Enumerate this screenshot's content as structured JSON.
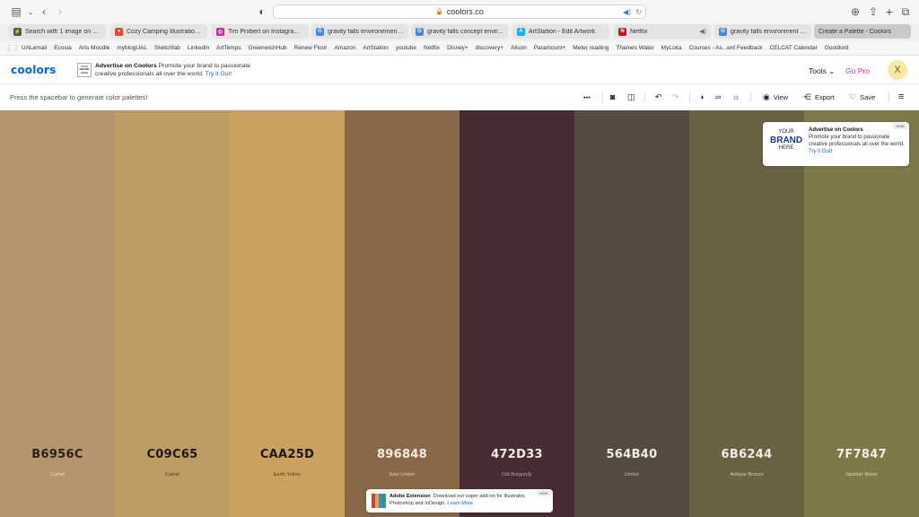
{
  "browser": {
    "url": "coolors.co",
    "tabs": [
      {
        "label": "Search with 1 image on Sa...",
        "fav_color": "#555555",
        "fav_glyph": "⚡"
      },
      {
        "label": "Cozy Camping Illustration,...",
        "fav_color": "#e8452c",
        "fav_glyph": "●"
      },
      {
        "label": "Tim Probert on Instagram:...",
        "fav_color": "#d6249f",
        "fav_glyph": "◎"
      },
      {
        "label": "gravity falls environement...",
        "fav_color": "#4285f4",
        "fav_glyph": "G"
      },
      {
        "label": "gravity falls concept envir...",
        "fav_color": "#4285f4",
        "fav_glyph": "G"
      },
      {
        "label": "ArtStation - Edit Artwork",
        "fav_color": "#13aff0",
        "fav_glyph": "A"
      },
      {
        "label": "Netflix",
        "fav_color": "#e50914",
        "fav_glyph": "N"
      },
      {
        "label": "gravity falls environment -...",
        "fav_color": "#4285f4",
        "fav_glyph": "G"
      },
      {
        "label": "Create a Palette - Coolors",
        "fav_color": "#0066ff",
        "fav_glyph": ""
      }
    ],
    "bookmarks": [
      "UALemail",
      "Ecosia",
      "Arts Moodle",
      "myblogUAL",
      "Sketchfab",
      "Linkedin",
      "ArtTemps",
      "GreenwichHub",
      "Renew Floor",
      "Amazon",
      "ArtStation",
      "youtube",
      "Netflix",
      "Disney+",
      "discovery+",
      "Alison",
      "Paramount+",
      "Meter reading",
      "Thames Water",
      "MyLoka",
      "Courses - As...ent Feedback",
      "CELCAT Calendar",
      "Goodlord"
    ]
  },
  "header": {
    "logo": "coolors",
    "ad_box": [
      "YOUR",
      "BRAND",
      "HERE"
    ],
    "ad_title": "Advertise on Coolors",
    "ad_body": "Promote your brand to passionate creative professionals all over the world.",
    "ad_link": "Try it Out!",
    "tools_label": "Tools",
    "gopro_label": "Go Pro",
    "avatar_initial": "X"
  },
  "toolbar": {
    "hint": "Press the spacebar to generate color palettes!",
    "view_label": "View",
    "export_label": "Export",
    "save_label": "Save"
  },
  "palette": [
    {
      "hex": "B6956C",
      "name": "Camel",
      "color": "#B6956C",
      "text": "#2b2218",
      "sub": "#e6d7c2"
    },
    {
      "hex": "C09C65",
      "name": "Camel",
      "color": "#C09C65",
      "text": "#1e1a12",
      "sub": "#4b3d27"
    },
    {
      "hex": "CAA25D",
      "name": "Earth Yellow",
      "color": "#CAA25D",
      "text": "#1e1a12",
      "sub": "#4e3f23"
    },
    {
      "hex": "896848",
      "name": "Raw Umber",
      "color": "#896848",
      "text": "#f3ece4",
      "sub": "#d6c6b4"
    },
    {
      "hex": "472D33",
      "name": "Old Burgundy",
      "color": "#472D33",
      "text": "#f3ece4",
      "sub": "#b9a8ac"
    },
    {
      "hex": "564B40",
      "name": "Umber",
      "color": "#564B40",
      "text": "#f3ece4",
      "sub": "#c3bbb2"
    },
    {
      "hex": "6B6244",
      "name": "Antique Bronze",
      "color": "#6B6244",
      "text": "#f3ece4",
      "sub": "#d3ccb6"
    },
    {
      "hex": "7F7847",
      "name": "Spanish Bistre",
      "color": "#7F7847",
      "text": "#f3ece4",
      "sub": "#ded9bd"
    }
  ],
  "side_ad": {
    "brand_lines": [
      "YOUR",
      "BRAND",
      "HERE"
    ],
    "title": "Advertise on Coolors",
    "body": "Promote your brand to passionate creative professionals all over the world.",
    "link": "Try it Out!",
    "hide": "HIDE"
  },
  "adobe_ad": {
    "title": "Adobe Extension",
    "body": "Download our super add-on for Illustrator, Photoshop and InDesign.",
    "link": "Learn More",
    "hide": "HIDE"
  }
}
